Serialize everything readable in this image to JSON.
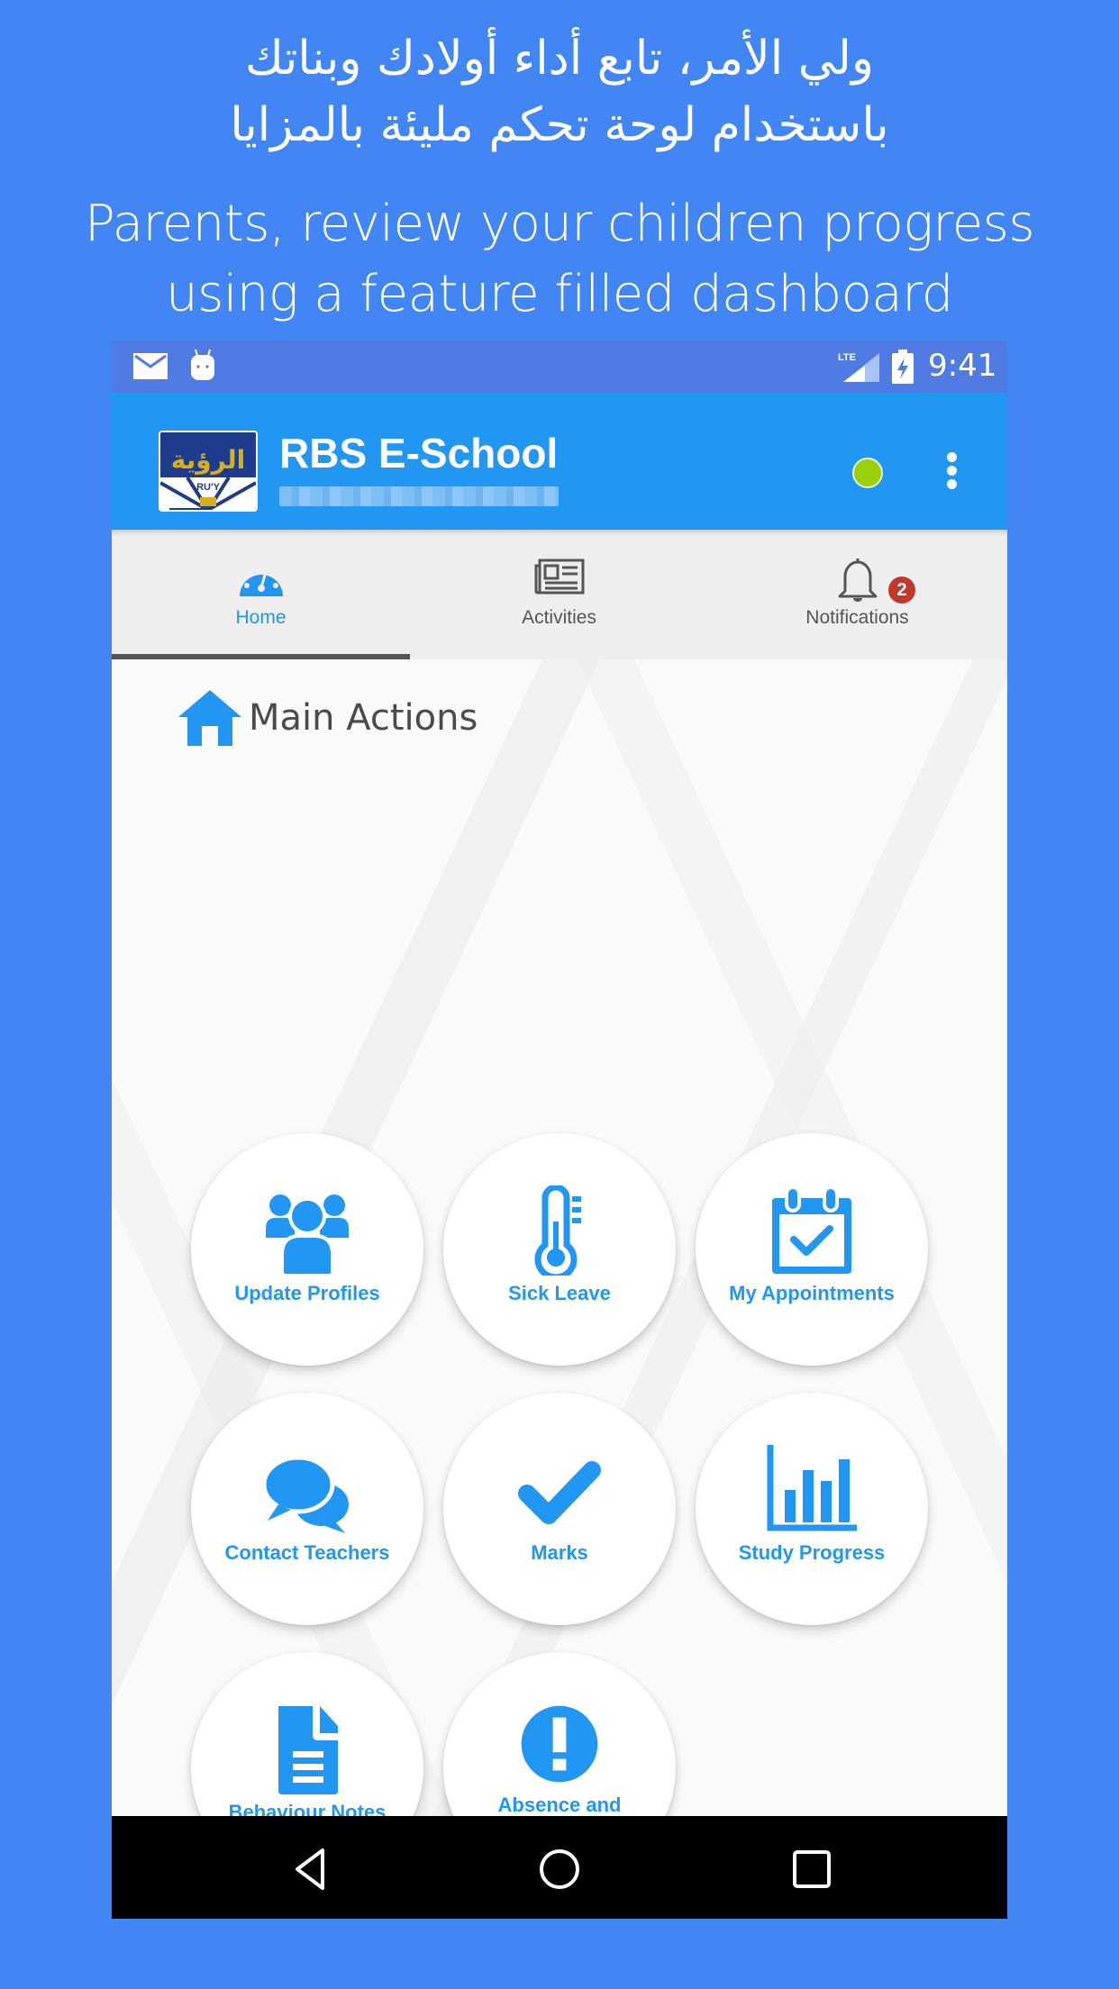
{
  "promo": {
    "arabic_line1": "ولي الأمر، تابع أداء أولادك وبناتك",
    "arabic_line2": "باستخدام لوحة تحكم مليئة بالمزايا",
    "english_line1": "Parents, review your children progress",
    "english_line2": "using a feature filled dashboard"
  },
  "status_bar": {
    "icons": [
      "mail-icon",
      "android-icon",
      "lte-signal-icon",
      "battery-charging-icon"
    ],
    "network": "LTE",
    "time": "9:41"
  },
  "app_bar": {
    "title": "RBS E-School",
    "subtitle_redacted": true,
    "status_color": "#9bcf0a"
  },
  "tabs": [
    {
      "label": "Home",
      "icon": "dashboard-icon",
      "active": true
    },
    {
      "label": "Activities",
      "icon": "newspaper-icon",
      "active": false
    },
    {
      "label": "Notifications",
      "icon": "bell-icon",
      "active": false,
      "badge": "2"
    }
  ],
  "main": {
    "section_title": "Main Actions",
    "actions": [
      {
        "label": "Update Profiles",
        "icon": "users-icon"
      },
      {
        "label": "Sick Leave",
        "icon": "thermometer-icon"
      },
      {
        "label": "My Appointments",
        "icon": "calendar-check-icon"
      },
      {
        "label": "Contact Teachers",
        "icon": "chat-bubbles-icon"
      },
      {
        "label": "Marks",
        "icon": "checkmark-icon"
      },
      {
        "label": "Study Progress",
        "icon": "bar-chart-icon"
      },
      {
        "label": "Behaviour Notes",
        "icon": "document-icon"
      },
      {
        "label": "Absence and Tardiness",
        "icon": "exclamation-circle-icon"
      }
    ]
  },
  "nav_bar": {
    "buttons": [
      "back",
      "home",
      "recents"
    ]
  },
  "colors": {
    "page_background": "#4285f4",
    "status_bar": "#4f7be3",
    "app_bar": "#2196f3",
    "accent": "#2196f3",
    "badge": "#c0392b"
  }
}
